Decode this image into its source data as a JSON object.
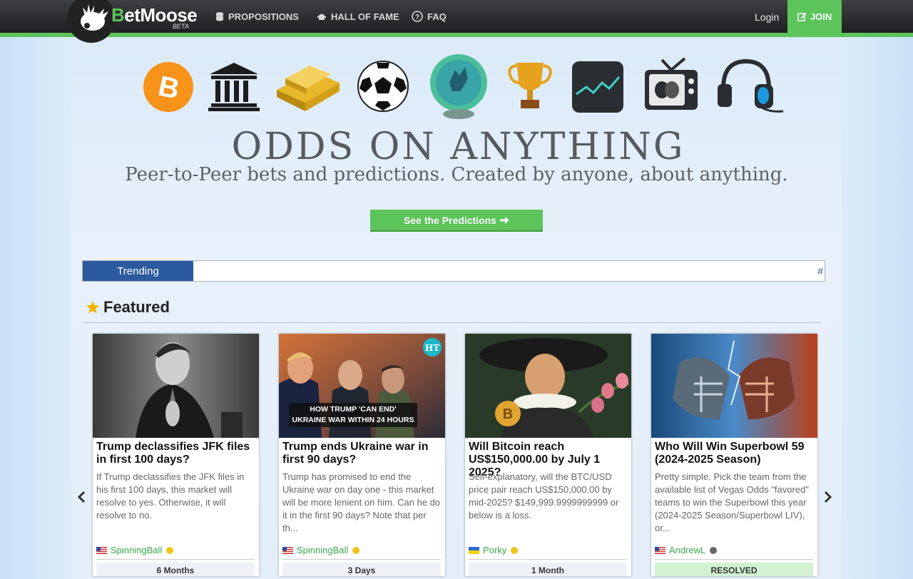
{
  "header": {
    "brand_first": "B",
    "brand_rest": "etMoose",
    "beta": "BETA",
    "nav": [
      {
        "label": "PROPOSITIONS",
        "icon": "coins-icon"
      },
      {
        "label": "HALL OF FAME",
        "icon": "hall-icon"
      },
      {
        "label": "FAQ",
        "icon": "question-icon"
      }
    ],
    "login": "Login",
    "join": "JOIN"
  },
  "hero": {
    "icons": [
      "bitcoin-icon",
      "bank-icon",
      "gold-bars-icon",
      "soccer-ball-icon",
      "crystal-ball-icon",
      "trophy-icon",
      "stock-chart-icon",
      "tv-theater-icon",
      "gaming-headset-icon"
    ],
    "title": "ODDS ON ANYTHING",
    "subtitle": "Peer-to-Peer bets and predictions. Created by anyone, about anything.",
    "cta": "See the Predictions"
  },
  "trending": {
    "label": "Trending",
    "trail": "#"
  },
  "featured": {
    "heading": "Featured",
    "cards": [
      {
        "title": "Trump declassifies JFK files in first 100 days?",
        "description": "If Trump declassifies the JFK files in his first 100 days, this market will resolve to yes. Otherwise, it will resolve to no.",
        "user": "SpinningBall",
        "flag": "us",
        "status_color": "#f0c419",
        "footer": "6 Months"
      },
      {
        "title": "Trump ends Ukraine war in first 90 days?",
        "description": "Trump has promised to end the Ukraine war on day one - this market will be more lenient on him. Can he do it in the first 90 days? Note that per th...",
        "user": "SpinningBall",
        "flag": "us",
        "status_color": "#f0c419",
        "footer": "3 Days",
        "image_caption": "HOW TRUMP 'CAN END' UKRAINE WAR WITHIN 24 HOURS",
        "image_badge": "HT"
      },
      {
        "title": "Will Bitcoin reach US$150,000.00 by July 1 2025?",
        "description": "Self-explanatory, will the BTC/USD price pair reach US$150,000.00 by mid-2025? $149,999.9999999999 or below is a loss.",
        "user": "Porky",
        "flag": "ua",
        "status_color": "#f0c419",
        "footer": "1 Month"
      },
      {
        "title": "Who Will Win Superbowl 59 (2024-2025 Season)",
        "description": "Pretty simple. Pick the team from the available list of Vegas Odds \"favored\" teams to win the Superbowl this year (2024-2025 Season/Superbowl LIV), or...",
        "user": "AndrewL",
        "flag": "us",
        "status_color": "#666666",
        "footer": "RESOLVED"
      }
    ]
  },
  "colors": {
    "accent_green": "#5cc45a",
    "trend_blue": "#2b5a9e",
    "star": "#f0b400"
  }
}
